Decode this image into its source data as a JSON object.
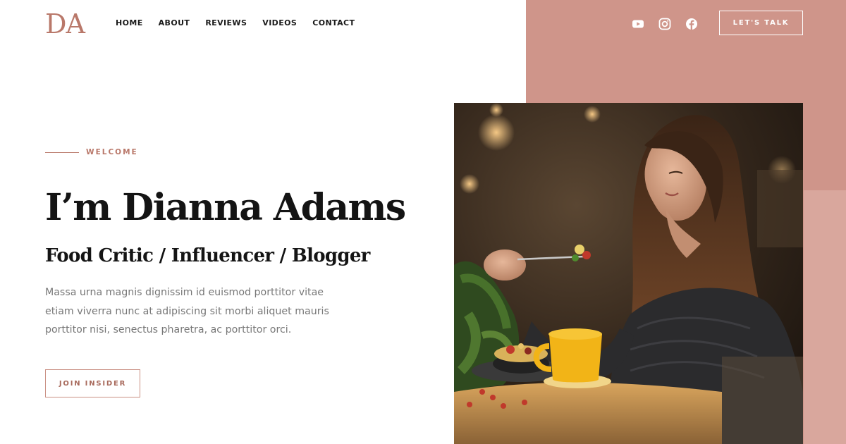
{
  "brand": {
    "logo": "DA"
  },
  "nav": {
    "items": [
      {
        "label": "HOME"
      },
      {
        "label": "ABOUT"
      },
      {
        "label": "REVIEWS"
      },
      {
        "label": "VIDEOS"
      },
      {
        "label": "CONTACT"
      }
    ]
  },
  "header": {
    "socials": [
      "youtube-icon",
      "instagram-icon",
      "facebook-icon"
    ],
    "cta_label": "LET'S TALK"
  },
  "hero": {
    "eyebrow": "WELCOME",
    "title": "I’m Dianna Adams",
    "subtitle": "Food Critic / Influencer / Blogger",
    "description": "Massa urna magnis dignissim id euismod porttitor vitae etiam viverra nunc at adipiscing sit morbi aliquet mauris porttitor nisi, senectus pharetra, ac porttitor orci.",
    "button_label": "JOIN INSIDER"
  },
  "colors": {
    "accent": "#cf958a",
    "brand_text": "#b9786a",
    "heading": "#141414",
    "body_text": "#777777"
  }
}
